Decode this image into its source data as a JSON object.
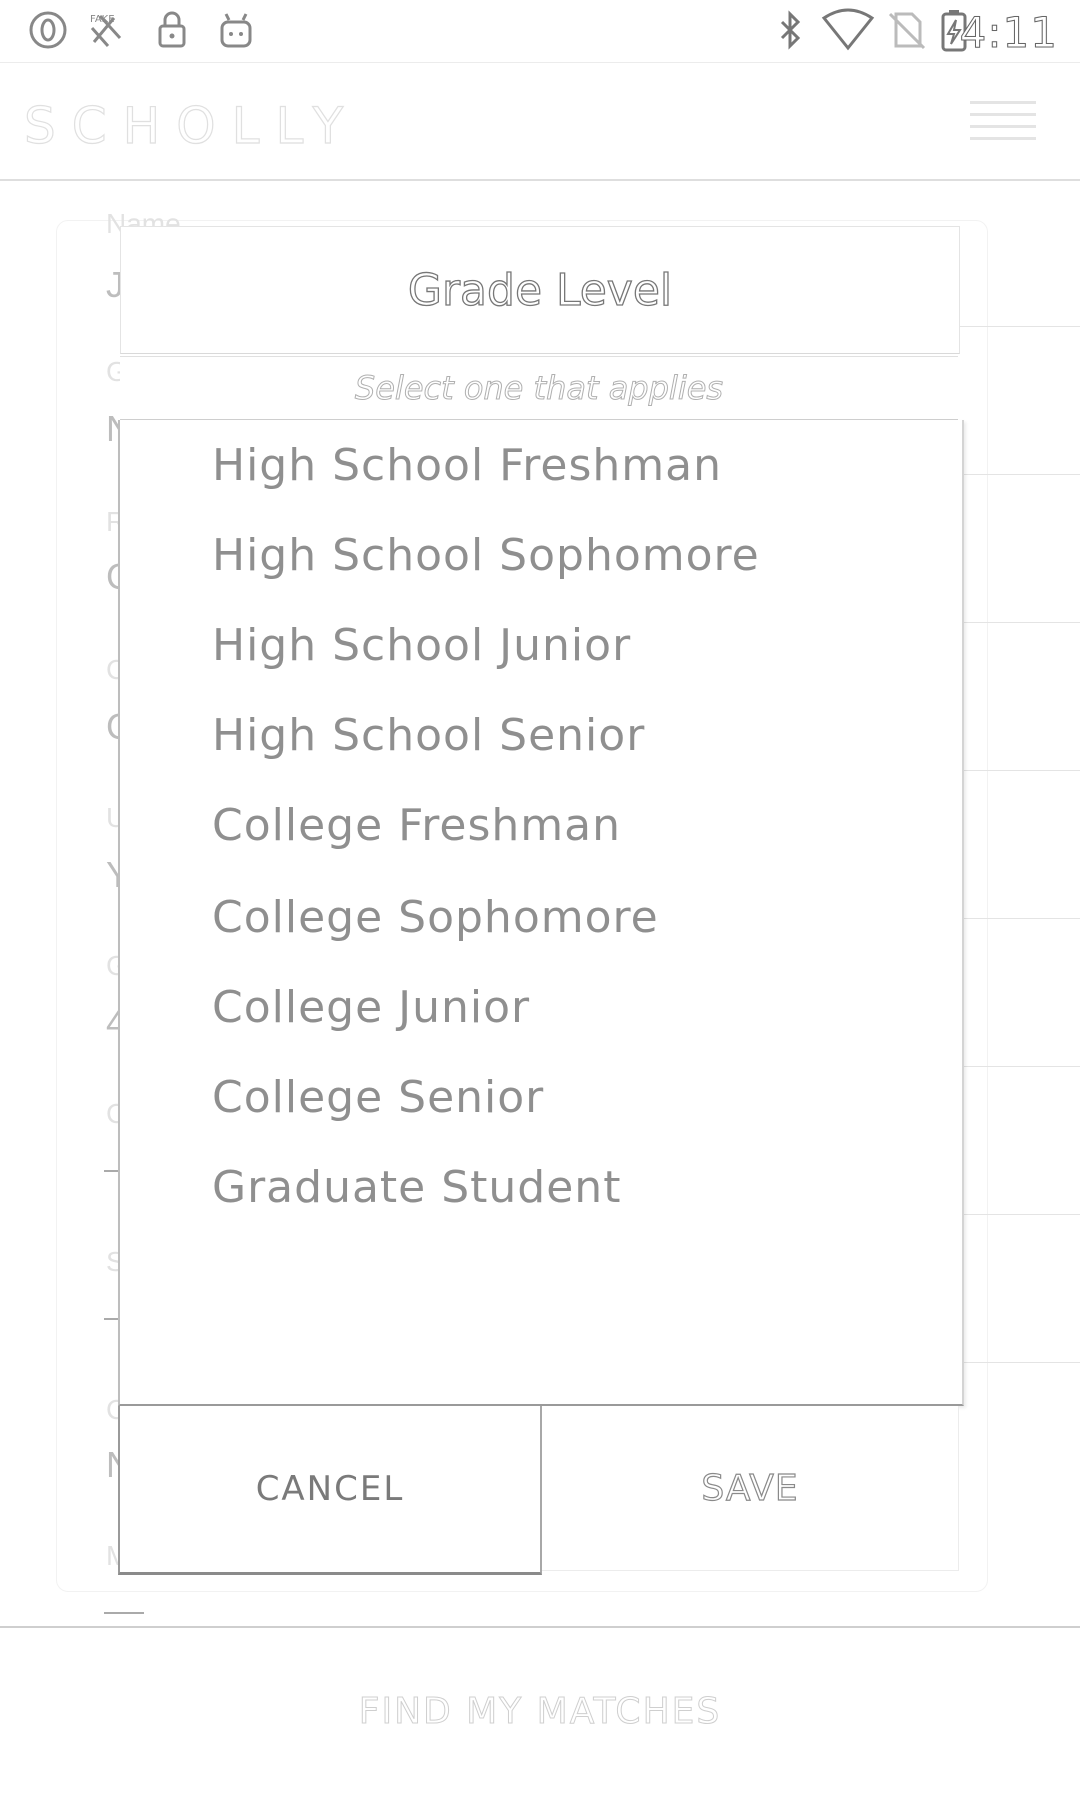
{
  "status_bar": {
    "time": "4:11",
    "left_icons": [
      "opera-icon",
      "fake-gps-icon",
      "lock-icon",
      "android-icon"
    ],
    "right_icons": [
      "bluetooth-icon",
      "wifi-icon",
      "no-sim-icon",
      "battery-charging-icon"
    ]
  },
  "header": {
    "brand": "SCHOLLY",
    "menu_icon": "hamburger-menu-icon"
  },
  "background_form": {
    "fields": [
      {
        "label": "Name",
        "value": "J"
      },
      {
        "label": "G",
        "value": "N"
      },
      {
        "label": "R",
        "value": "C"
      },
      {
        "label": "C",
        "value": "C"
      },
      {
        "label": "U",
        "value": "Y"
      },
      {
        "label": "G",
        "value": "4"
      },
      {
        "label": "C",
        "value": ""
      },
      {
        "label": "S",
        "value": ""
      },
      {
        "label": "C",
        "value": "N"
      },
      {
        "label": "M",
        "value": ""
      }
    ]
  },
  "dialog": {
    "title": "Grade Level",
    "subtitle": "Select one that applies",
    "options": [
      "High School Freshman",
      "High School Sophomore",
      "High School Junior",
      "High School Senior",
      "College Freshman",
      "College Sophomore",
      "College Junior",
      "College Senior",
      "Graduate Student"
    ],
    "cancel_label": "CANCEL",
    "save_label": "SAVE"
  },
  "footer": {
    "cta_label": "FIND MY MATCHES"
  }
}
